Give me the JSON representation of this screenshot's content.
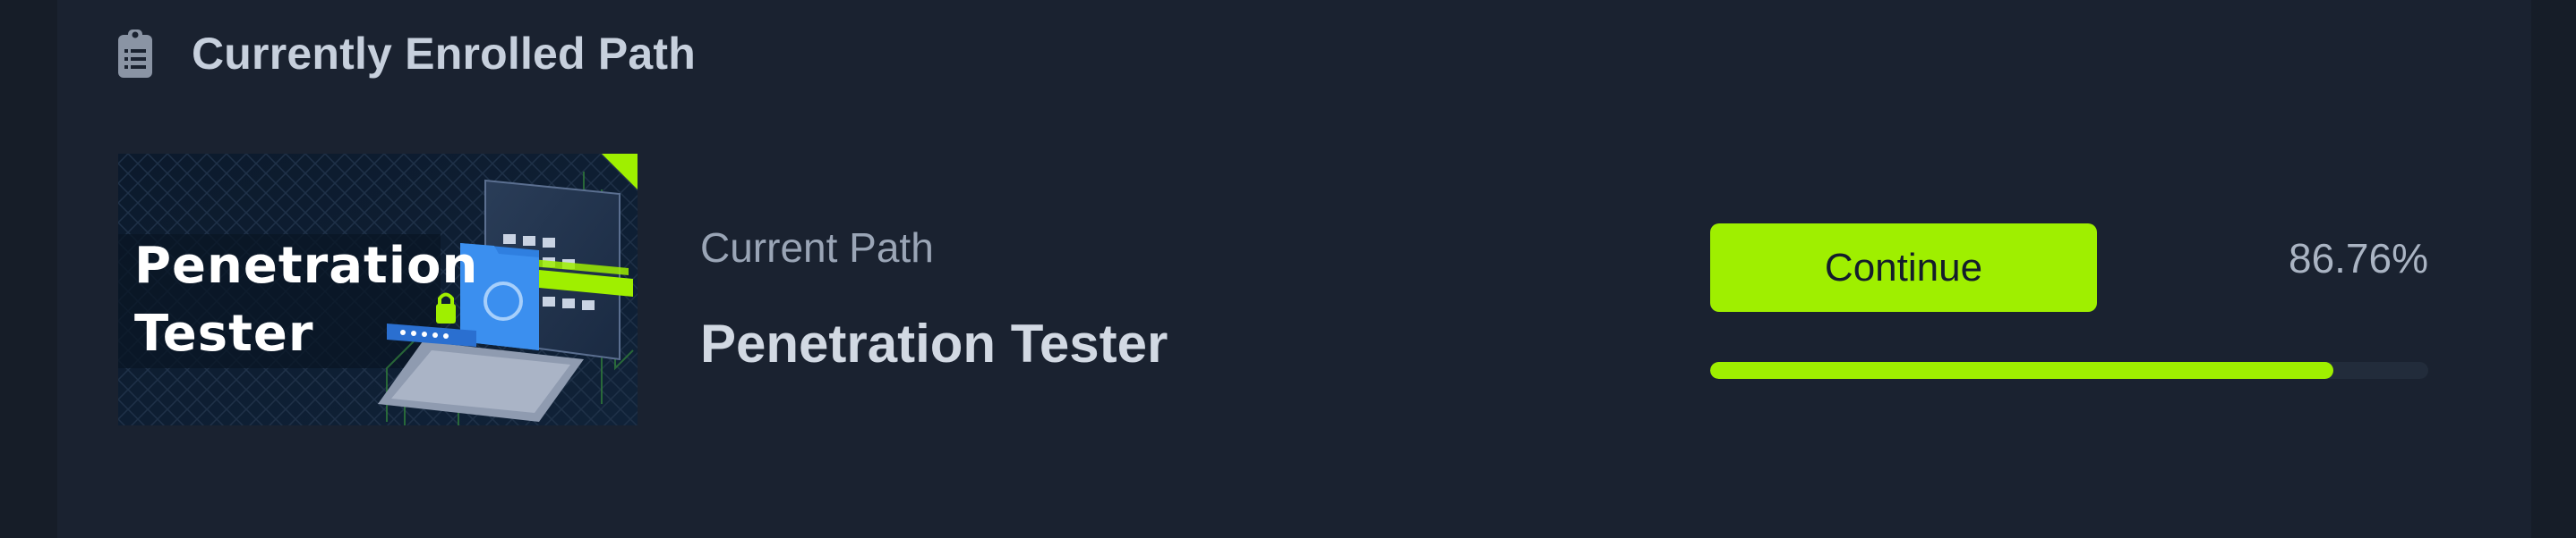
{
  "section": {
    "title": "Currently Enrolled Path",
    "icon": "clipboard-list-icon"
  },
  "path": {
    "thumbnail_text": "Penetration\nTester",
    "label": "Current Path",
    "name": "Penetration Tester"
  },
  "actions": {
    "continue_label": "Continue"
  },
  "progress": {
    "percent_text": "86.76%",
    "fraction": 0.8676
  },
  "colors": {
    "background": "#1a2230",
    "accent": "#9fef00",
    "title_text": "#c7d0dd",
    "muted_text": "#9aa5b6"
  }
}
